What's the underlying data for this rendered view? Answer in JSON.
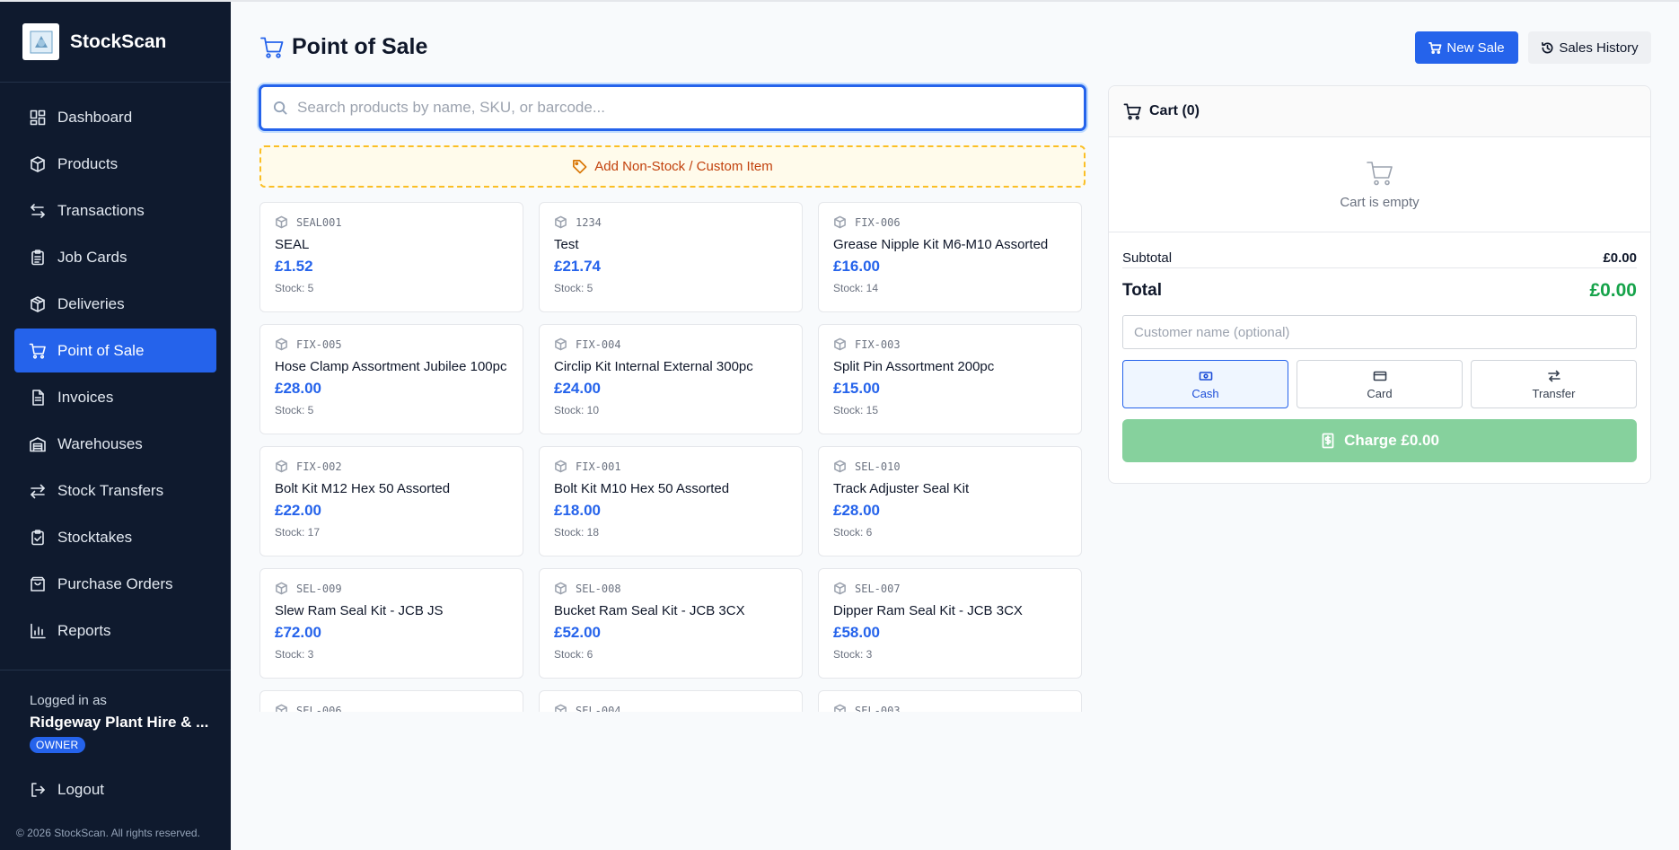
{
  "app": {
    "name": "StockScan"
  },
  "sidebar": {
    "items": [
      {
        "label": "Dashboard",
        "icon": "dashboard-icon"
      },
      {
        "label": "Products",
        "icon": "box-icon"
      },
      {
        "label": "Transactions",
        "icon": "arrows-icon"
      },
      {
        "label": "Job Cards",
        "icon": "clipboard-icon"
      },
      {
        "label": "Deliveries",
        "icon": "package-icon"
      },
      {
        "label": "Point of Sale",
        "icon": "cart-icon",
        "active": true
      },
      {
        "label": "Invoices",
        "icon": "document-icon"
      },
      {
        "label": "Warehouses",
        "icon": "warehouse-icon"
      },
      {
        "label": "Stock Transfers",
        "icon": "transfer-icon"
      },
      {
        "label": "Stocktakes",
        "icon": "clipboard-check-icon"
      },
      {
        "label": "Purchase Orders",
        "icon": "shopping-bag-icon"
      },
      {
        "label": "Reports",
        "icon": "bar-chart-icon"
      }
    ],
    "logged_in_label": "Logged in as",
    "user_name": "Ridgeway Plant Hire & ...",
    "role": "OWNER",
    "logout_label": "Logout",
    "copyright": "© 2026 StockScan. All rights reserved."
  },
  "header": {
    "title": "Point of Sale",
    "new_sale_label": "New Sale",
    "history_label": "Sales History"
  },
  "search": {
    "placeholder": "Search products by name, SKU, or barcode..."
  },
  "custom_item_label": "Add Non-Stock / Custom Item",
  "products": [
    {
      "sku": "SEAL001",
      "name": "SEAL",
      "price": "£1.52",
      "stock": "Stock: 5"
    },
    {
      "sku": "1234",
      "name": "Test",
      "price": "£21.74",
      "stock": "Stock: 5"
    },
    {
      "sku": "FIX-006",
      "name": "Grease Nipple Kit M6-M10 Assorted",
      "price": "£16.00",
      "stock": "Stock: 14"
    },
    {
      "sku": "FIX-005",
      "name": "Hose Clamp Assortment Jubilee 100pc",
      "price": "£28.00",
      "stock": "Stock: 5"
    },
    {
      "sku": "FIX-004",
      "name": "Circlip Kit Internal External 300pc",
      "price": "£24.00",
      "stock": "Stock: 10"
    },
    {
      "sku": "FIX-003",
      "name": "Split Pin Assortment 200pc",
      "price": "£15.00",
      "stock": "Stock: 15"
    },
    {
      "sku": "FIX-002",
      "name": "Bolt Kit M12 Hex 50 Assorted",
      "price": "£22.00",
      "stock": "Stock: 17"
    },
    {
      "sku": "FIX-001",
      "name": "Bolt Kit M10 Hex 50 Assorted",
      "price": "£18.00",
      "stock": "Stock: 18"
    },
    {
      "sku": "SEL-010",
      "name": "Track Adjuster Seal Kit",
      "price": "£28.00",
      "stock": "Stock: 6"
    },
    {
      "sku": "SEL-009",
      "name": "Slew Ram Seal Kit - JCB JS",
      "price": "£72.00",
      "stock": "Stock: 3"
    },
    {
      "sku": "SEL-008",
      "name": "Bucket Ram Seal Kit - JCB 3CX",
      "price": "£52.00",
      "stock": "Stock: 6"
    },
    {
      "sku": "SEL-007",
      "name": "Dipper Ram Seal Kit - JCB 3CX",
      "price": "£58.00",
      "stock": "Stock: 3"
    },
    {
      "sku": "SEL-006",
      "name": "",
      "price": "",
      "stock": ""
    },
    {
      "sku": "SEL-004",
      "name": "",
      "price": "",
      "stock": ""
    },
    {
      "sku": "SEL-003",
      "name": "",
      "price": "",
      "stock": ""
    }
  ],
  "cart": {
    "title": "Cart (0)",
    "empty_text": "Cart is empty",
    "subtotal_label": "Subtotal",
    "subtotal_value": "£0.00",
    "total_label": "Total",
    "total_value": "£0.00",
    "customer_placeholder": "Customer name (optional)",
    "payment_methods": [
      {
        "label": "Cash",
        "icon": "cash-icon",
        "selected": true
      },
      {
        "label": "Card",
        "icon": "card-icon",
        "selected": false
      },
      {
        "label": "Transfer",
        "icon": "transfer-icon",
        "selected": false
      }
    ],
    "charge_label": "Charge £0.00"
  },
  "colors": {
    "accent": "#2563eb",
    "sidebar_bg": "#0f1a2e",
    "total_green": "#16a34a",
    "charge_disabled": "#86d19d",
    "custom_border": "#fbbf24"
  }
}
